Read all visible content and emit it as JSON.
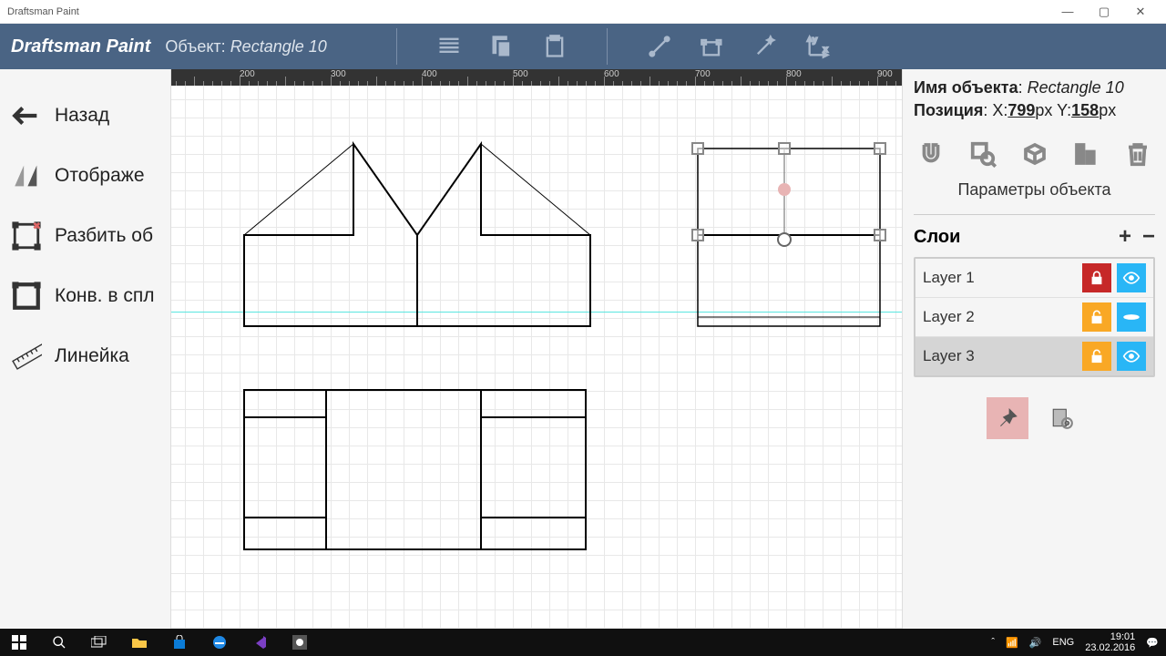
{
  "window": {
    "title": "Draftsman Paint"
  },
  "toolbar": {
    "app_name": "Draftsman Paint",
    "object_prefix": "Объект:",
    "object_value": "Rectangle 10"
  },
  "ruler": {
    "marks": [
      200,
      300,
      400,
      500,
      600,
      700,
      800,
      900
    ]
  },
  "left": {
    "back": "Назад",
    "display": "Отображе",
    "break": "Разбить об",
    "conv": "Конв. в спл",
    "ruler": "Линейка"
  },
  "right": {
    "name_label": "Имя объекта",
    "name_value": "Rectangle 10",
    "pos_label": "Позиция",
    "pos_x_prefix": "X:",
    "pos_x": "799",
    "pos_y_prefix": "Y:",
    "pos_y": "158",
    "px": "px",
    "params": "Параметры объекта",
    "layers_label": "Слои",
    "layers": [
      {
        "name": "Layer 1",
        "locked": true,
        "visible": true,
        "selected": false
      },
      {
        "name": "Layer 2",
        "locked": false,
        "visible": false,
        "selected": false
      },
      {
        "name": "Layer 3",
        "locked": false,
        "visible": true,
        "selected": true
      }
    ]
  },
  "taskbar": {
    "lang": "ENG",
    "time": "19:01",
    "date": "23.02.2016"
  }
}
